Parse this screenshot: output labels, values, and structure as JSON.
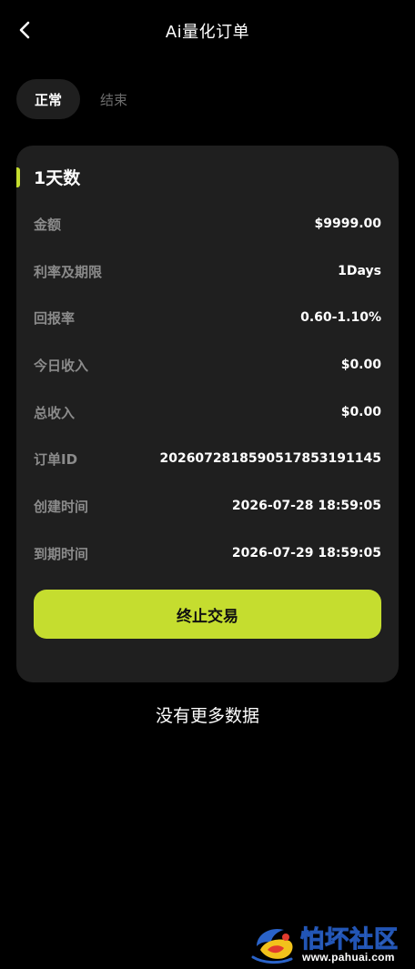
{
  "header": {
    "title": "Ai量化订单",
    "back_icon": "chevron-left-icon"
  },
  "tabs": [
    {
      "label": "正常",
      "active": true
    },
    {
      "label": "结束",
      "active": false
    }
  ],
  "order": {
    "title": "1天数",
    "rows": [
      {
        "label": "金额",
        "value": "$9999.00"
      },
      {
        "label": "利率及期限",
        "value": "1Days"
      },
      {
        "label": "回报率",
        "value": "0.60-1.10%"
      },
      {
        "label": "今日收入",
        "value": "$0.00"
      },
      {
        "label": "总收入",
        "value": "$0.00"
      },
      {
        "label": "订单ID",
        "value": "2026072818590517853191145"
      },
      {
        "label": "创建时间",
        "value": "2026-07-28 18:59:05"
      },
      {
        "label": "到期时间",
        "value": "2026-07-29 18:59:05"
      }
    ],
    "terminate_label": "终止交易"
  },
  "list_footer": "没有更多数据",
  "watermark": {
    "name": "怕坏社区",
    "url": "www.pahuai.com"
  },
  "colors": {
    "background": "#000000",
    "card": "#1f1f1f",
    "accent": "#c5dd2f",
    "label": "#8b8b8b"
  }
}
